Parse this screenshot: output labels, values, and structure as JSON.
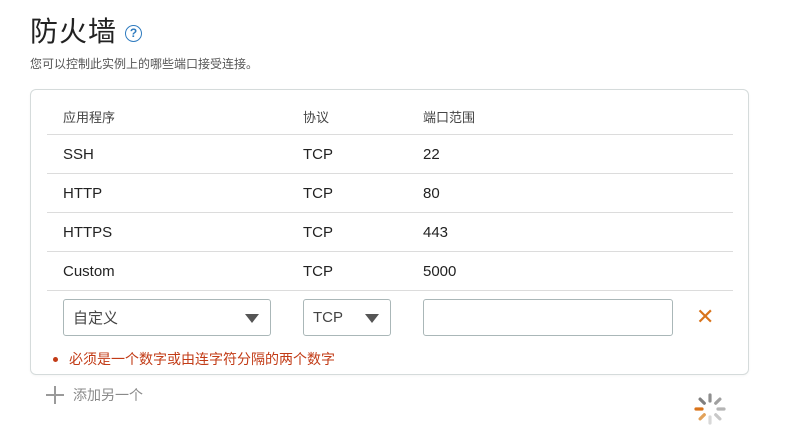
{
  "header": {
    "title": "防火墙",
    "help_icon": "help-icon",
    "help_glyph": "?",
    "subtitle": "您可以控制此实例上的哪些端口接受连接。"
  },
  "table": {
    "columns": [
      "应用程序",
      "协议",
      "端口范围"
    ],
    "rows": [
      {
        "app": "SSH",
        "protocol": "TCP",
        "port": "22"
      },
      {
        "app": "HTTP",
        "protocol": "TCP",
        "port": "80"
      },
      {
        "app": "HTTPS",
        "protocol": "TCP",
        "port": "443"
      },
      {
        "app": "Custom",
        "protocol": "TCP",
        "port": "5000"
      }
    ]
  },
  "new_rule": {
    "app_selected": "自定义",
    "protocol_selected": "TCP",
    "port_value": "",
    "remove_glyph": "✕",
    "error": "必须是一个数字或由连字符分隔的两个数字"
  },
  "add_another": "添加另一个",
  "colors": {
    "error": "#c23b16",
    "remove": "#d9731a",
    "accent": "#2f7bbf"
  }
}
